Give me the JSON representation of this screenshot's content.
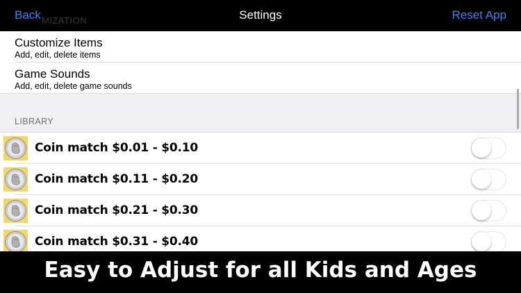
{
  "navbar": {
    "back_label": "Back",
    "title": "Settings",
    "reset_label": "Reset App",
    "accent_color": "#3b82f6"
  },
  "customization": {
    "header_fragment": "MIZATION",
    "items": [
      {
        "title": "Customize Items",
        "subtitle": "Add, edit, delete items"
      },
      {
        "title": "Game Sounds",
        "subtitle": "Add, edit, delete game sounds"
      }
    ]
  },
  "library": {
    "header": "LIBRARY",
    "items": [
      {
        "label": "Coin match $0.01 - $0.10",
        "icon": "quarter-coin-icon",
        "enabled": false
      },
      {
        "label": "Coin match $0.11 - $0.20",
        "icon": "quarter-coin-icon",
        "enabled": false
      },
      {
        "label": "Coin match $0.21 - $0.30",
        "icon": "quarter-coin-icon",
        "enabled": false
      },
      {
        "label": "Coin match $0.31 - $0.40",
        "icon": "quarter-coin-icon",
        "enabled": false
      }
    ]
  },
  "caption": {
    "text": "Easy to Adjust for all Kids and Ages"
  }
}
